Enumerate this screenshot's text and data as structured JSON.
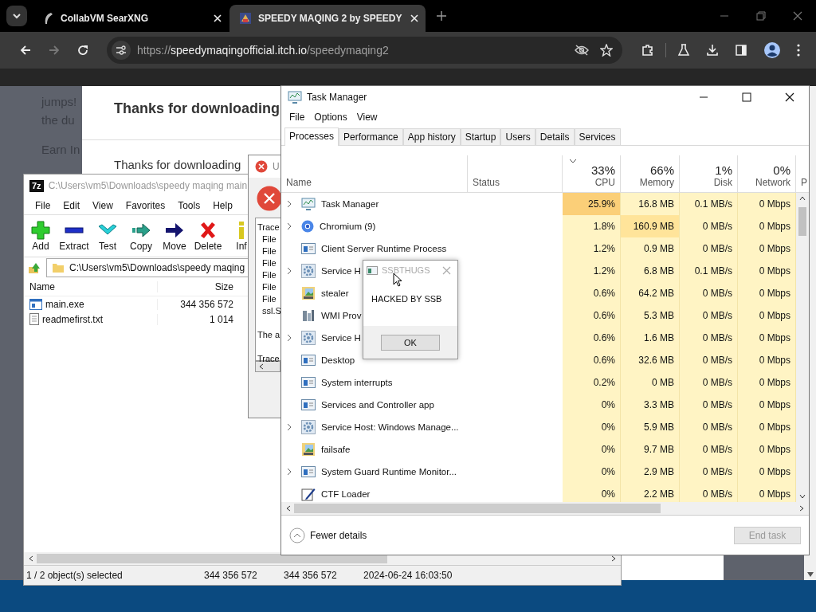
{
  "browser": {
    "tabs": [
      {
        "title": "CollabVM SearXNG",
        "selected": false
      },
      {
        "title": "SPEEDY MAQING 2 by SPEEDY",
        "selected": true
      }
    ],
    "forward": {
      "disabled": true
    },
    "address": {
      "scheme": "https://",
      "host": "speedymaqingofficial.itch.io",
      "path": "/speedymaqing2"
    }
  },
  "page": {
    "side_lines": [
      "jumps!",
      "the du",
      "Earn In"
    ],
    "heading": "Thanks for downloading",
    "text": "Thanks for downloading"
  },
  "error_dialog": {
    "title": "U",
    "paragraphs": [
      [
        "Trace",
        "File",
        "File",
        "File",
        "File",
        "File",
        "File",
        "ssl.S"
      ],
      [
        "The a"
      ],
      [
        "Trace"
      ]
    ]
  },
  "archiver": {
    "badge": "7z",
    "title": "C:\\Users\\vm5\\Downloads\\speedy maqing main",
    "menu": [
      "File",
      "Edit",
      "View",
      "Favorites",
      "Tools",
      "Help"
    ],
    "toolbar": [
      {
        "label": "Add",
        "kind": "add"
      },
      {
        "label": "Extract",
        "kind": "extract"
      },
      {
        "label": "Test",
        "kind": "test"
      },
      {
        "label": "Copy",
        "kind": "copy"
      },
      {
        "label": "Move",
        "kind": "move"
      },
      {
        "label": "Delete",
        "kind": "delete"
      },
      {
        "label": "Inf",
        "kind": "info"
      }
    ],
    "path": "C:\\Users\\vm5\\Downloads\\speedy maqing",
    "columns": [
      "Name",
      "Size"
    ],
    "files": [
      {
        "name": "main.exe",
        "size": "344 356 572",
        "kind": "exe"
      },
      {
        "name": "readmefirst.txt",
        "size": "1 014",
        "kind": "text"
      }
    ],
    "status": [
      "1 / 2 object(s) selected",
      "344 356 572",
      "344 356 572",
      "2024-06-24 16:03:50"
    ]
  },
  "task_manager": {
    "title": "Task Manager",
    "menu": [
      "File",
      "Options",
      "View"
    ],
    "tabs": [
      {
        "label": "Processes",
        "selected": true
      },
      {
        "label": "Performance",
        "selected": false
      },
      {
        "label": "App history",
        "selected": false
      },
      {
        "label": "Startup",
        "selected": false
      },
      {
        "label": "Users",
        "selected": false
      },
      {
        "label": "Details",
        "selected": false
      },
      {
        "label": "Services",
        "selected": false
      }
    ],
    "columns": [
      {
        "label": "Name",
        "sorted": false
      },
      {
        "label": "Status",
        "sorted": false
      },
      {
        "usage": "33%",
        "label": "CPU",
        "sorted": true
      },
      {
        "usage": "66%",
        "label": "Memory",
        "sorted": false
      },
      {
        "usage": "1%",
        "label": "Disk",
        "sorted": false
      },
      {
        "usage": "0%",
        "label": "Network",
        "sorted": false
      },
      {
        "label": "P",
        "sorted": false
      }
    ],
    "rows": [
      {
        "name": "Task Manager",
        "kind": "chart",
        "expandable": true,
        "cpu": "25.9%",
        "memory": "16.8 MB",
        "disk": "0.1 MB/s",
        "network": "0 Mbps",
        "cpu_hot": true,
        "memory_hot": false
      },
      {
        "name": "Chromium (9)",
        "kind": "browser",
        "expandable": true,
        "cpu": "1.8%",
        "memory": "160.9 MB",
        "disk": "0 MB/s",
        "network": "0 Mbps",
        "cpu_hot": false,
        "memory_hot": true
      },
      {
        "name": "Client Server Runtime Process",
        "kind": "window",
        "expandable": false,
        "cpu": "1.2%",
        "memory": "0.9 MB",
        "disk": "0 MB/s",
        "network": "0 Mbps",
        "cpu_hot": false,
        "memory_hot": false
      },
      {
        "name": "Service H",
        "kind": "gear",
        "expandable": true,
        "cpu": "1.2%",
        "memory": "6.8 MB",
        "disk": "0.1 MB/s",
        "network": "0 Mbps",
        "cpu_hot": false,
        "memory_hot": false
      },
      {
        "name": "stealer",
        "kind": "image",
        "expandable": false,
        "cpu": "0.6%",
        "memory": "64.2 MB",
        "disk": "0 MB/s",
        "network": "0 Mbps",
        "cpu_hot": false,
        "memory_hot": false
      },
      {
        "name": "WMI Prov",
        "kind": "server",
        "expandable": false,
        "cpu": "0.6%",
        "memory": "5.3 MB",
        "disk": "0 MB/s",
        "network": "0 Mbps",
        "cpu_hot": false,
        "memory_hot": false
      },
      {
        "name": "Service H",
        "kind": "gear",
        "expandable": true,
        "cpu": "0.6%",
        "memory": "1.6 MB",
        "disk": "0 MB/s",
        "network": "0 Mbps",
        "cpu_hot": false,
        "memory_hot": false
      },
      {
        "name": "Desktop",
        "kind": "window",
        "expandable": false,
        "cpu": "0.6%",
        "memory": "32.6 MB",
        "disk": "0 MB/s",
        "network": "0 Mbps",
        "cpu_hot": false,
        "memory_hot": false
      },
      {
        "name": "System interrupts",
        "kind": "window",
        "expandable": false,
        "cpu": "0.2%",
        "memory": "0 MB",
        "disk": "0 MB/s",
        "network": "0 Mbps",
        "cpu_hot": false,
        "memory_hot": false
      },
      {
        "name": "Services and Controller app",
        "kind": "window",
        "expandable": false,
        "cpu": "0%",
        "memory": "3.3 MB",
        "disk": "0 MB/s",
        "network": "0 Mbps",
        "cpu_hot": false,
        "memory_hot": false
      },
      {
        "name": "Service Host: Windows Manage...",
        "kind": "gear",
        "expandable": true,
        "cpu": "0%",
        "memory": "5.9 MB",
        "disk": "0 MB/s",
        "network": "0 Mbps",
        "cpu_hot": false,
        "memory_hot": false
      },
      {
        "name": "failsafe",
        "kind": "image",
        "expandable": false,
        "cpu": "0%",
        "memory": "9.7 MB",
        "disk": "0 MB/s",
        "network": "0 Mbps",
        "cpu_hot": false,
        "memory_hot": false
      },
      {
        "name": "System Guard Runtime Monitor...",
        "kind": "window",
        "expandable": true,
        "cpu": "0%",
        "memory": "2.9 MB",
        "disk": "0 MB/s",
        "network": "0 Mbps",
        "cpu_hot": false,
        "memory_hot": false
      },
      {
        "name": "CTF Loader",
        "kind": "pen",
        "expandable": false,
        "cpu": "0%",
        "memory": "2.2 MB",
        "disk": "0 MB/s",
        "network": "0 Mbps",
        "cpu_hot": false,
        "memory_hot": false
      }
    ],
    "footer": {
      "toggle": "Fewer details",
      "end_task": {
        "label": "End task",
        "disabled": true
      }
    }
  },
  "popup": {
    "title": "SSBTHUGS",
    "message": "HACKED BY SSB",
    "button": "OK"
  }
}
